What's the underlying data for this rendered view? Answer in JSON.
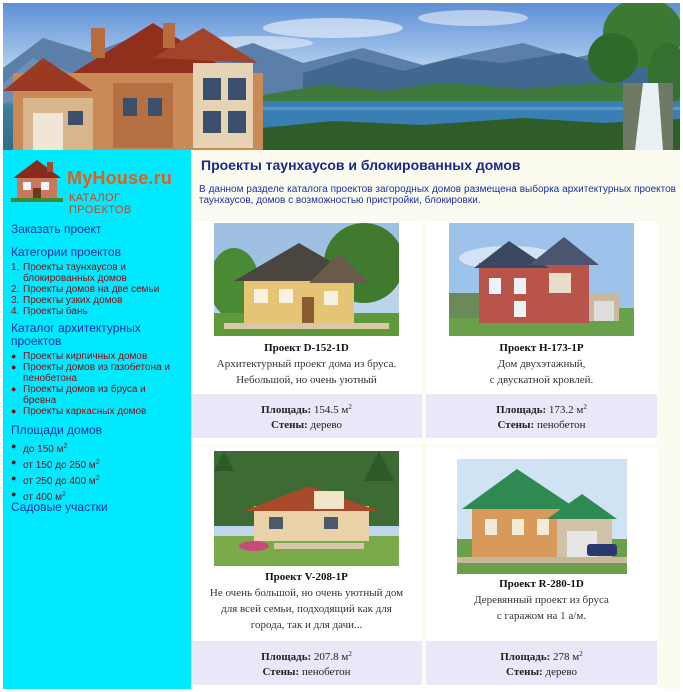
{
  "sidebar": {
    "logo_text": "MyHouse.ru",
    "logo_sub": "КАТАЛОГ ПРОЕКТОВ",
    "order_link": "Заказать проект",
    "categories_heading": "Категории проектов",
    "categories": [
      {
        "num": "1.",
        "label": "Проекты таунхаусов и блокированных домов"
      },
      {
        "num": "2.",
        "label": "Проекты домов на две семьи"
      },
      {
        "num": "3.",
        "label": "Проекты узких домов"
      },
      {
        "num": "4.",
        "label": "Проекты бань"
      }
    ],
    "catalog_heading": "Каталог архитектурных проектов",
    "catalog": [
      "Проекты кирпичных домов",
      "Проекты домов из газобетона и пенобетона",
      "Проекты домов из бруса и бревна",
      "Проекты каркасных домов"
    ],
    "areas_heading": "Площади домов",
    "areas": [
      "до 150 м",
      "от 150 до 250 м",
      "от 250 до 400 м",
      "от 400 м"
    ],
    "area_sup": "2",
    "garden_link": "Садовые участки"
  },
  "main": {
    "title": "Проекты таунхаусов и блокированных домов",
    "intro": "В данном разделе каталога проектов загородных домов размещена выборка архитектурных проектов таунхаусов, домов с возможностью пристройки, блокировки.",
    "area_label": "Площадь:",
    "walls_label": "Стены:",
    "area_sup": "2",
    "projects": [
      {
        "name": "Проект D-152-1D",
        "desc1": "Архитектурный проект дома из бруса.",
        "desc2": "Небольшой, но очень уютный",
        "desc3": "",
        "area": "154.5 м",
        "walls": "дерево"
      },
      {
        "name": "Проект H-173-1P",
        "desc1": "Дом двухэтажный,",
        "desc2": "с двускатной кровлей.",
        "desc3": "",
        "area": "173.2 м",
        "walls": "пенобетон"
      },
      {
        "name": "Проект V-208-1P",
        "desc1": "Не очень большой, но очень уютный дом",
        "desc2": "для всей семьи, подходящий как для",
        "desc3": "города, так и для дачи...",
        "area": "207.8 м",
        "walls": "пенобетон"
      },
      {
        "name": "Проект R-280-1D",
        "desc1": "Деревянный проект из бруса",
        "desc2": "с гаражом на 1 а/м.",
        "desc3": "",
        "area": "278 м",
        "walls": "дерево"
      }
    ]
  }
}
